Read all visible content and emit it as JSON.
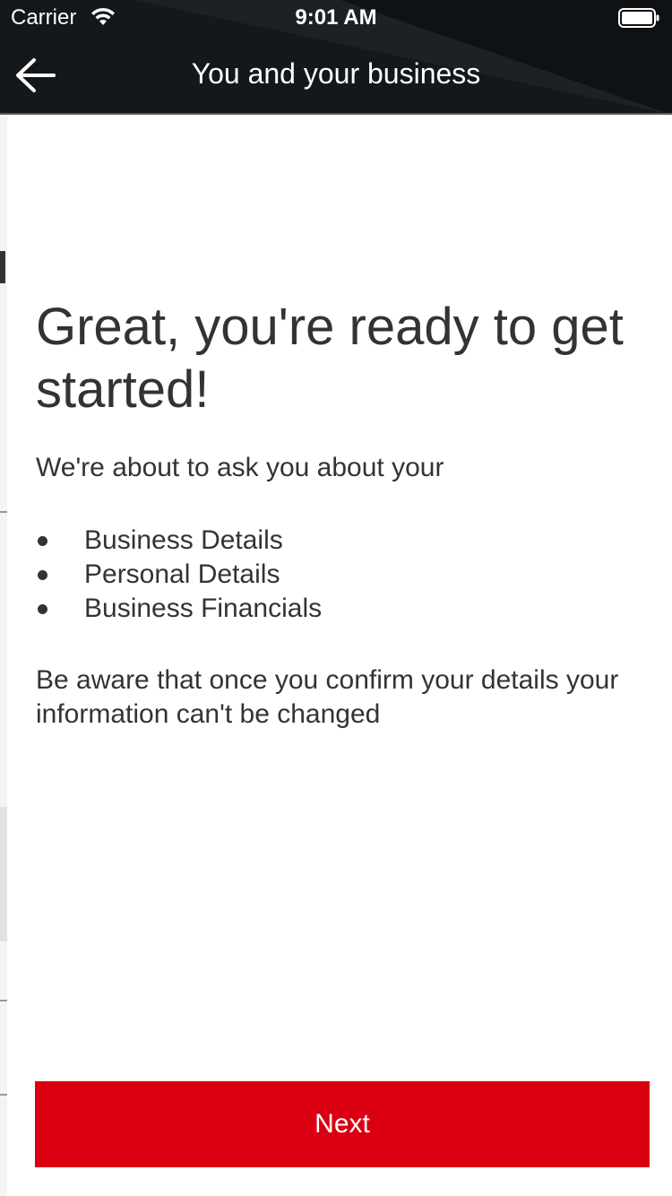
{
  "status_bar": {
    "carrier": "Carrier",
    "time": "9:01 AM",
    "wifi_icon": "wifi-icon",
    "battery_icon": "battery-full-icon"
  },
  "nav": {
    "back_icon": "arrow-left-icon",
    "title": "You and your business"
  },
  "content": {
    "headline": "Great, you're ready to get started!",
    "intro": "We're about to ask you about your",
    "items": [
      {
        "label": "Business Details"
      },
      {
        "label": "Personal Details"
      },
      {
        "label": "Business Financials"
      }
    ],
    "warning": "Be aware that once you confirm your details your information can't be changed"
  },
  "footer": {
    "next_label": "Next"
  },
  "colors": {
    "header_bg": "#14181b",
    "primary_button": "#db0011",
    "text": "#333333"
  }
}
